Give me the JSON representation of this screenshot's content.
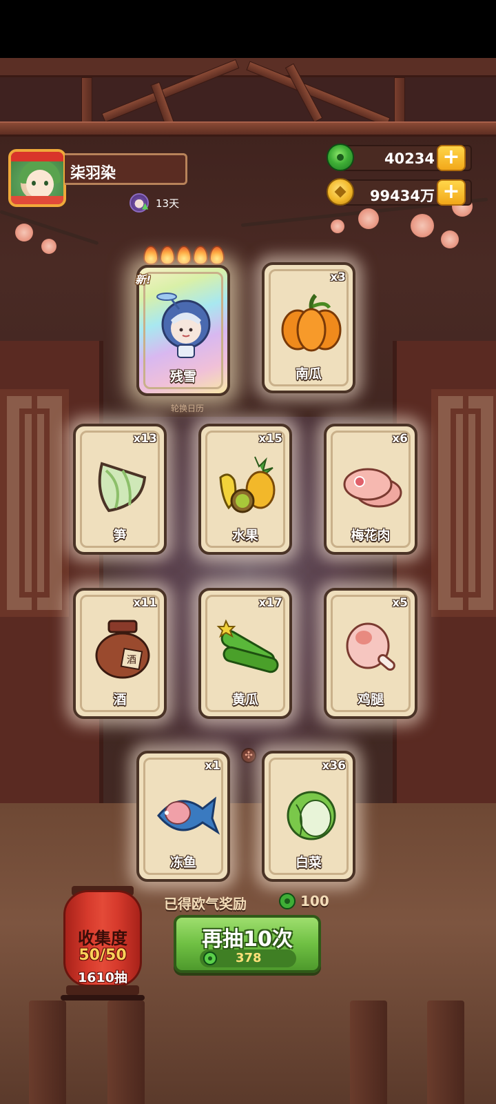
{
  "profile": {
    "name": "柒羽染",
    "days_label": "13天"
  },
  "currency": {
    "jade": "40234",
    "coins": "99434万",
    "plus_symbol": "+"
  },
  "special_card": {
    "badge": "新!",
    "name": "残雪",
    "stars": 5,
    "caption": "轮换日历"
  },
  "cards": [
    {
      "name": "南瓜",
      "count": "x3",
      "icon": "pumpkin-icon"
    },
    {
      "name": "笋",
      "count": "x13",
      "icon": "bamboo-shoot-icon"
    },
    {
      "name": "水果",
      "count": "x15",
      "icon": "fruit-icon"
    },
    {
      "name": "梅花肉",
      "count": "x6",
      "icon": "pork-icon"
    },
    {
      "name": "酒",
      "count": "x11",
      "icon": "wine-jar-icon"
    },
    {
      "name": "黄瓜",
      "count": "x17",
      "icon": "cucumber-icon"
    },
    {
      "name": "鸡腿",
      "count": "x5",
      "icon": "drumstick-icon"
    },
    {
      "name": "冻鱼",
      "count": "x1",
      "icon": "frozen-fish-icon"
    },
    {
      "name": "白菜",
      "count": "x36",
      "icon": "cabbage-icon"
    }
  ],
  "reward": {
    "label": "已得欧气奖励",
    "value": "100"
  },
  "draw_button": {
    "label": "再抽10次",
    "cost": "378"
  },
  "collection": {
    "title": "收集度",
    "progress": "50/50",
    "draws": "1610抽"
  },
  "colors": {
    "accent_green": "#6fc043",
    "card_bg": "#efdfbd",
    "lantern_red": "#d63a2c",
    "gold": "#f2a81a"
  }
}
